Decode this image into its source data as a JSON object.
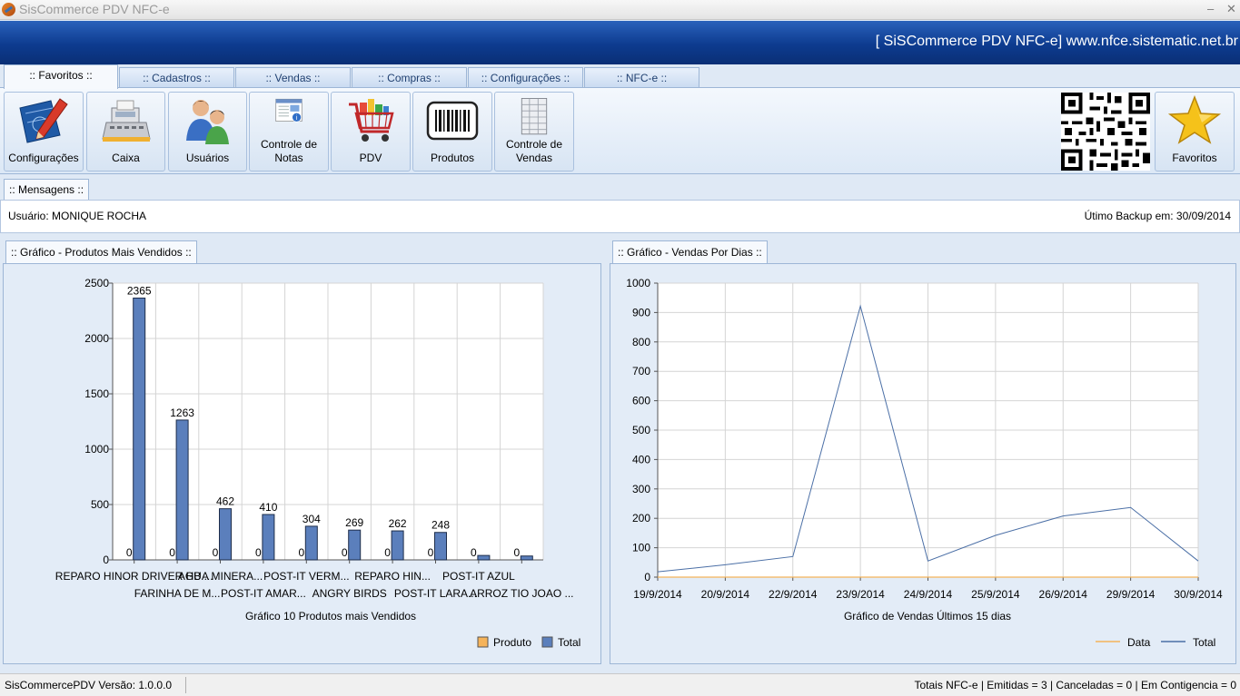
{
  "window": {
    "title": "SisCommerce PDV NFC-e",
    "minimize": "–",
    "close": "✕"
  },
  "banner": {
    "text": "[ SiSCommerce PDV NFC-e] www.nfce.sistematic.net.br"
  },
  "tabs": [
    {
      "label": ":: Favoritos ::"
    },
    {
      "label": ":: Cadastros ::"
    },
    {
      "label": ":: Vendas ::"
    },
    {
      "label": ":: Compras ::"
    },
    {
      "label": ":: Configurações ::"
    },
    {
      "label": ":: NFC-e ::"
    }
  ],
  "ribbon": {
    "buttons": [
      {
        "label": "Configurações",
        "icon": "blueprint-pencil-icon"
      },
      {
        "label": "Caixa",
        "icon": "cash-register-icon"
      },
      {
        "label": "Usuários",
        "icon": "users-icon"
      },
      {
        "label": "Controle de\nNotas",
        "icon": "invoice-icon"
      },
      {
        "label": "PDV",
        "icon": "shopping-cart-icon"
      },
      {
        "label": "Produtos",
        "icon": "barcode-icon"
      },
      {
        "label": "Controle de\nVendas",
        "icon": "spreadsheet-icon"
      }
    ],
    "favorites_label": "Favoritos"
  },
  "messages": {
    "tab": ":: Mensagens ::",
    "user": "Usuário: MONIQUE  ROCHA",
    "backup": "Útimo Backup em: 30/09/2014"
  },
  "colors": {
    "bar": "#5b7fbc",
    "produto": "#f5b35a",
    "line": "#4b6fa6",
    "banner": "#0d3b8f"
  },
  "chart_data": [
    {
      "panel_title": ":: Gráfico - Produtos Mais Vendidos ::",
      "type": "bar",
      "title": "Gráfico 10 Produtos mais Vendidos",
      "categories": [
        "REPARO HINOR DRIVER HB ...",
        "FARINHA DE M...",
        "AGUA MINERA...",
        "POST-IT AMAR...",
        "POST-IT VERM...",
        "ANGRY BIRDS",
        "REPARO HIN...",
        "POST-IT LARA...",
        "POST-IT AZUL",
        "ARROZ TIO JOAO ..."
      ],
      "series": [
        {
          "name": "Produto",
          "values": [
            0,
            0,
            0,
            0,
            0,
            0,
            0,
            0,
            0,
            0
          ],
          "labels": [
            "0",
            "0",
            "0",
            "0",
            "0",
            "0",
            "0",
            "0",
            "0",
            "0"
          ]
        },
        {
          "name": "Total",
          "values": [
            2365,
            1263,
            462,
            410,
            304,
            269,
            262,
            248,
            40,
            35
          ],
          "labels": [
            "2365",
            "1263",
            "462",
            "410",
            "304",
            "269",
            "262",
            "248",
            "",
            ""
          ]
        }
      ],
      "ylim": [
        0,
        2500
      ],
      "yticks": [
        0,
        500,
        1000,
        1500,
        2000,
        2500
      ],
      "grid": true,
      "legend": "bottom-right"
    },
    {
      "panel_title": ":: Gráfico - Vendas Por Dias ::",
      "type": "line",
      "title": "Gráfico de Vendas Últimos 15 dias",
      "x": [
        "19/9/2014",
        "20/9/2014",
        "22/9/2014",
        "23/9/2014",
        "24/9/2014",
        "25/9/2014",
        "26/9/2014",
        "29/9/2014",
        "30/9/2014"
      ],
      "series": [
        {
          "name": "Data",
          "values": [
            0,
            0,
            0,
            0,
            0,
            0,
            0,
            0,
            0
          ]
        },
        {
          "name": "Total",
          "values": [
            18,
            42,
            70,
            922,
            55,
            142,
            208,
            237,
            55
          ]
        }
      ],
      "ylim": [
        0,
        1000
      ],
      "yticks": [
        0,
        100,
        200,
        300,
        400,
        500,
        600,
        700,
        800,
        900,
        1000
      ],
      "grid": true,
      "legend": "bottom-right"
    }
  ],
  "status": {
    "version": "SisCommercePDV Versão: 1.0.0.0",
    "totals": "Totais NFC-e | Emitidas = 3 | Canceladas = 0 | Em Contigencia = 0"
  }
}
